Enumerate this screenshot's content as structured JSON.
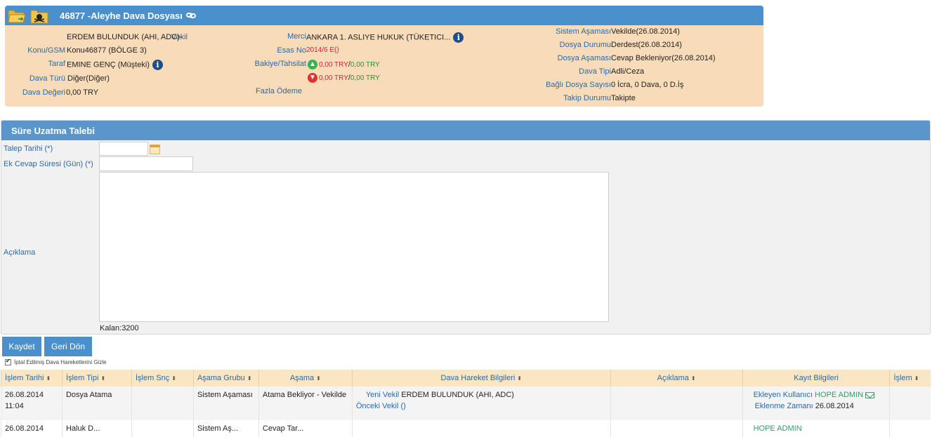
{
  "case": {
    "title": "46877 -Aleyhe Dava Dosyası",
    "left": [
      {
        "label": "Vekil",
        "value": "ERDEM BULUNDUK (AHI, ADC)-"
      },
      {
        "label": "Konu/GSM",
        "value": "Konu46877 (BÖLGE 3)"
      },
      {
        "label": "Taraf",
        "value": "EMINE GENÇ (Müşteki)"
      },
      {
        "label": "Dava Türü",
        "value": "Diğer(Diğer)"
      },
      {
        "label": "Dava Değeri",
        "value": "0,00 TRY"
      }
    ],
    "merci_label": "Merci",
    "merci_value": "ANKARA 1. ASLIYE HUKUK (TÜKETICI...",
    "esas_label": "Esas No",
    "esas_value": "2014/6 E()",
    "bakiye_label": "Bakiye/Tahsilat",
    "bakiye_red": "0,00 TRY",
    "bakiye_sep": "/",
    "bakiye_green": "0,00 TRY",
    "bakiye2_red": "0,00 TRY",
    "bakiye2_green": "0,00 TRY",
    "fazla_label": "Fazla Ödeme",
    "right": [
      {
        "label": "Sistem Aşaması",
        "value": "Vekilde(26.08.2014)"
      },
      {
        "label": "Dosya Durumu",
        "value": "Derdest(26.08.2014)"
      },
      {
        "label": "Dosya Aşaması",
        "value": "Cevap Bekleniyor(26.08.2014)"
      },
      {
        "label": "Dava Tipi",
        "value": "Adli/Ceza"
      },
      {
        "label": "Bağlı Dosya Sayısı",
        "value": "0 İcra, 0 Dava, 0 D.İş"
      },
      {
        "label": "Takip Durumu",
        "value": "Takipte"
      }
    ]
  },
  "form": {
    "title": "Süre Uzatma Talebi",
    "talep_label": "Talep Tarihi (*)",
    "ek_label": "Ek Cevap Süresi (Gün) (*)",
    "aciklama_label": "Açıklama",
    "talep_value": "",
    "ek_value": "",
    "aciklama_value": "",
    "kalan": "Kalan:3200",
    "save_label": "Kaydet",
    "back_label": "Geri Dön",
    "hide_cancelled_label": "İptal Edilmiş Dava Hareketlerini Gizle"
  },
  "table": {
    "columns": [
      "İşlem Tarihi",
      "İşlem Tipi",
      "İşlem Snç",
      "Aşama Grubu",
      "Aşama",
      "Dava Hareket Bilgileri",
      "Açıklama",
      "Kayıt Bilgileri",
      "İşlem"
    ],
    "rows": [
      {
        "tarih": "26.08.2014",
        "saat": "11:04",
        "tip": "Dosya Atama",
        "snc": "",
        "grup": "Sistem Aşaması",
        "asama": "Atama Bekliyor - Vekilde",
        "yeni_label": "Yeni Vekil",
        "yeni_value": "ERDEM BULUNDUK (AHI, ADC)",
        "onceki_label": "Önceki Vekil",
        "onceki_value": "()",
        "aciklama": "",
        "ekleyen_label": "Ekleyen Kullanıcı",
        "ekleyen_value": "HOPE ADMIN",
        "zaman_label": "Eklenme Zamanı",
        "zaman_value": "26.08.2014"
      },
      {
        "tarih": "26.08.2014",
        "tip": "Haluk D...",
        "grup": "Sistem Aş...",
        "asama": "Cevap Tar...",
        "ekleyen_value": "HOPE ADMIN"
      }
    ]
  }
}
